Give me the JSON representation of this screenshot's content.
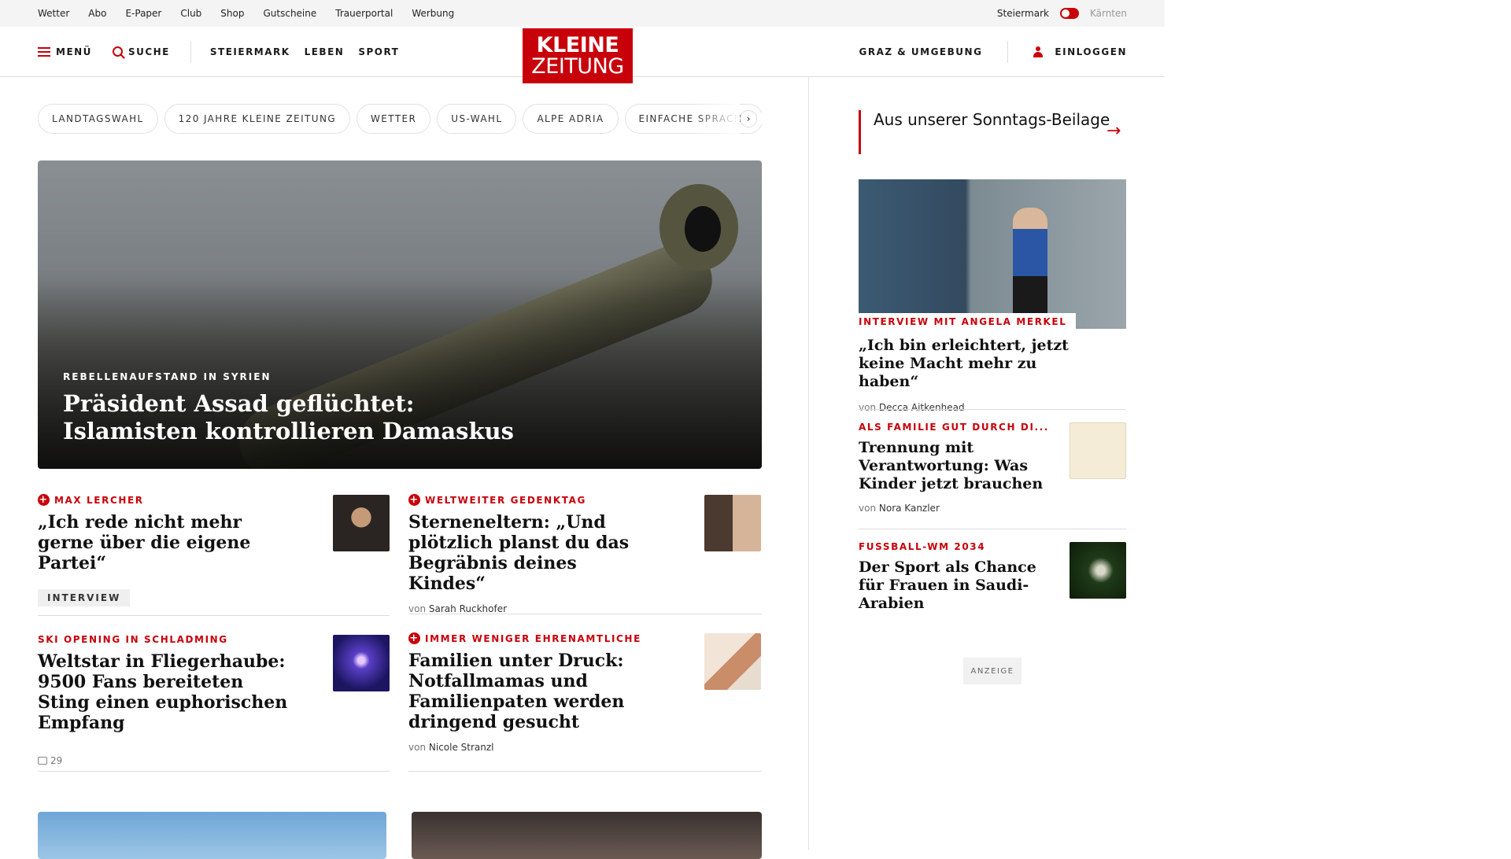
{
  "topbar": {
    "links": [
      "Wetter",
      "Abo",
      "E-Paper",
      "Club",
      "Shop",
      "Gutscheine",
      "Trauerportal",
      "Werbung"
    ],
    "region_active": "Steiermark",
    "region_inactive": "Kärnten"
  },
  "header": {
    "menu_label": "MENÜ",
    "search_label": "SUCHE",
    "nav": [
      "STEIERMARK",
      "LEBEN",
      "SPORT"
    ],
    "logo_line1": "KLEINE",
    "logo_line2": "ZEITUNG",
    "graz_label": "GRAZ & UMGEBUNG",
    "login_label": "EINLOGGEN"
  },
  "chips": [
    "LANDTAGSWAHL",
    "120 JAHRE KLEINE ZEITUNG",
    "WETTER",
    "US-WAHL",
    "ALPE ADRIA",
    "EINFACHE SPRACHE"
  ],
  "chip_next": "›",
  "hero": {
    "kicker": "REBELLENAUFSTAND IN SYRIEN",
    "title_line1": "Präsident Assad geflüchtet:",
    "title_line2": "Islamisten kontrollieren Damaskus"
  },
  "articles": [
    {
      "kicker": "MAX LERCHER",
      "plus": true,
      "title": "„Ich rede nicht mehr gerne über die eigene Partei“",
      "badge": "INTERVIEW"
    },
    {
      "kicker": "WELTWEITER GEDENKTAG",
      "plus": true,
      "title": "Sterneneltern: „Und plötzlich planst du das Begräbnis deines Kindes“",
      "by_prefix": "von",
      "author": "Sarah Ruckhofer"
    },
    {
      "kicker": "SKI OPENING IN SCHLADMING",
      "plus": false,
      "title": "Weltstar in Fliegerhaube: 9500 Fans bereiteten Sting einen euphorischen Empfang",
      "comments": "29"
    },
    {
      "kicker": "IMMER WENIGER EHRENAMTLICHE",
      "plus": true,
      "title": "Familien unter Druck: Notfallmamas und Familienpaten werden dringend gesucht",
      "by_prefix": "von",
      "author": "Nicole Stranzl"
    }
  ],
  "sidebar": {
    "heading": "Aus unserer Sonntags-Beilage",
    "arrow": "→",
    "feature": {
      "kicker": "INTERVIEW MIT ANGELA MERKEL",
      "title": "„Ich bin erleichtert, jetzt keine Macht mehr zu haben“",
      "by_prefix": "von",
      "author": "Decca Aitkenhead"
    },
    "items": [
      {
        "kicker": "ALS FAMILIE GUT DURCH DI...",
        "title": "Trennung mit Verantwortung: Was Kinder jetzt brauchen",
        "by_prefix": "von",
        "author": "Nora Kanzler"
      },
      {
        "kicker": "FUSSBALL-WM 2034",
        "title": "Der Sport als Chance für Frauen in Saudi-Arabien"
      }
    ],
    "ad_label": "ANZEIGE"
  },
  "colors": {
    "brand": "#c8000a",
    "rule": "#dddddd"
  }
}
